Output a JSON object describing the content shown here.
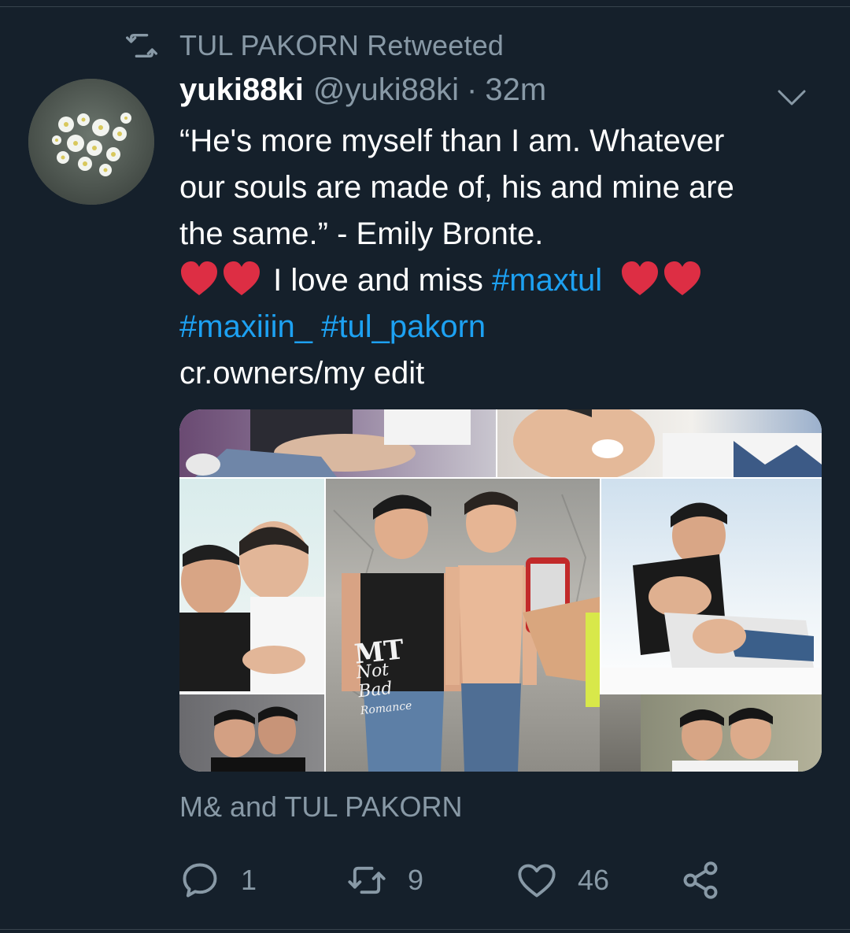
{
  "retweet": {
    "icon": "retweet-icon",
    "text": "TUL PAKORN Retweeted"
  },
  "tweet": {
    "display_name": "yuki88ki",
    "handle": "@yuki88ki",
    "separator": "·",
    "time": "32m",
    "text_lines": {
      "l1": "“He's more myself than I am. Whatever",
      "l2": "our souls are made of, his and mine are",
      "l3": "the same.” - Emily Bronte.",
      "l4_text": " I love and miss ",
      "l4_hashtag": "#maxtul",
      "l5_hashtag1": "#maxiiin_",
      "l5_hashtag2": "#tul_pakorn",
      "l6": "cr.owners/my edit"
    },
    "media": {
      "shirt_text_1": "MT",
      "shirt_text_2": "Not",
      "shirt_text_3": "Bad",
      "shirt_text_4": "Romance"
    },
    "attribution": "M& and TUL PAKORN"
  },
  "actions": {
    "reply_count": "1",
    "retweet_count": "9",
    "like_count": "46"
  },
  "colors": {
    "background": "#15202b",
    "muted": "#8899a6",
    "link": "#1da1f2",
    "heart": "#e0245e"
  }
}
